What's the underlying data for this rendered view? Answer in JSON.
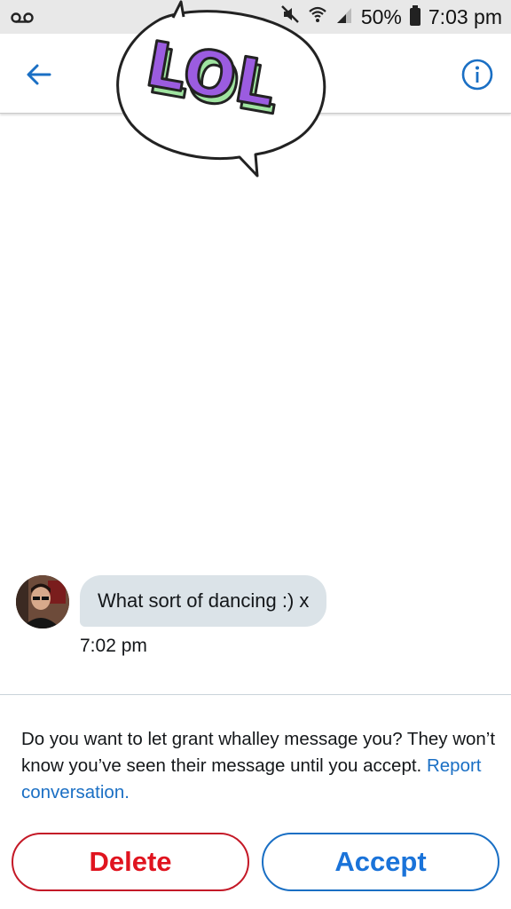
{
  "status_bar": {
    "voicemail_icon": "voicemail-icon",
    "mute_icon": "mute-icon",
    "wifi_icon": "wifi-icon",
    "signal_icon": "signal-icon",
    "battery_percent": "50%",
    "time": "7:03 pm"
  },
  "header": {
    "back_icon": "back-arrow-icon",
    "info_icon": "info-icon",
    "sticker_text": "LOL"
  },
  "message": {
    "text": "What sort of dancing :) x",
    "time": "7:02 pm"
  },
  "request": {
    "prompt": "Do you want to let grant whalley message you? They won’t know you’ve seen their message until you accept.",
    "report_link": "Report conversation."
  },
  "actions": {
    "delete_label": "Delete",
    "accept_label": "Accept"
  },
  "colors": {
    "accent_blue": "#1a73d9",
    "delete_red": "#e0141f",
    "bubble": "#dbe3e8",
    "sticker_purple": "#9b5ce0",
    "sticker_green": "#9fe3a0"
  }
}
